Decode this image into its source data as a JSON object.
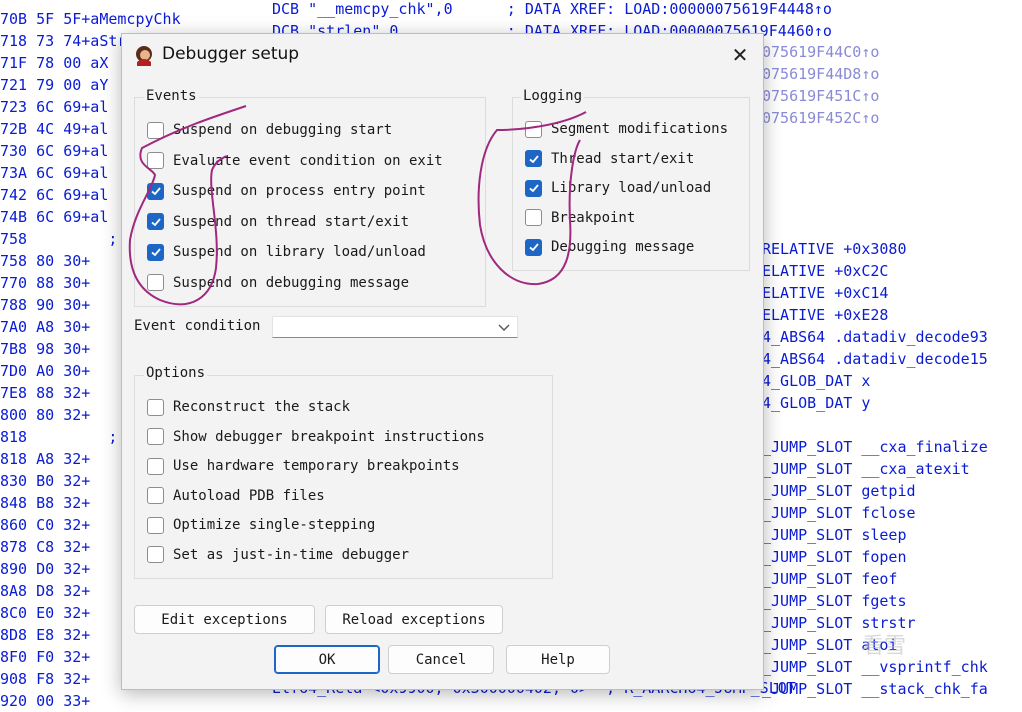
{
  "background": {
    "left_lines": [
      "70B 5F 5F+aMemcpyChk",
      "718 73 74+aStrlen",
      "71F 78 00 aX",
      "721 79 00 aY",
      "723 6C 69+al",
      "72B 4C 49+al",
      "730 6C 69+al",
      "73A 6C 69+al",
      "742 6C 69+al",
      "74B 6C 69+al",
      "758         ;",
      "758 80 30+",
      "770 88 30+",
      "788 90 30+",
      "7A0 A8 30+",
      "7B8 98 30+",
      "7D0 A0 30+",
      "7E8 88 32+",
      "800 80 32+",
      "818         ;",
      "818 A8 32+",
      "830 B0 32+",
      "848 B8 32+",
      "860 C0 32+",
      "878 C8 32+",
      "890 D0 32+",
      "8A8 D8 32+",
      "8C0 E0 32+",
      "8D8 E8 32+",
      "8F0 F0 32+",
      "908 F8 32+",
      "920 00 33+"
    ],
    "top_right_1": "DCB \"__memcpy_chk\",0      ; DATA XREF: LOAD:00000075619F4448↑o",
    "top_right_2": "DCB \"strlen\",0            ; DATA XREF: LOAD:00000075619F4460↑o",
    "xref_lines": [
      "075619F44C0↑o",
      "075619F44D8↑o",
      "075619F451C↑o",
      "075619F452C↑o"
    ],
    "reloc_lines": [
      "RELATIVE +0x3080",
      "ELATIVE +0xC2C",
      "ELATIVE +0xC14",
      "ELATIVE +0xE28",
      "4_ABS64 .datadiv_decode93",
      "4_ABS64 .datadiv_decode15",
      "4_GLOB_DAT x",
      "4_GLOB_DAT y",
      "",
      "_JUMP_SLOT __cxa_finalize",
      "_JUMP_SLOT __cxa_atexit",
      "_JUMP_SLOT getpid",
      "_JUMP_SLOT fclose",
      "_JUMP_SLOT sleep",
      "_JUMP_SLOT fopen",
      "_JUMP_SLOT feof",
      "_JUMP_SLOT fgets",
      "_JUMP_SLOT strstr",
      "_JUMP_SLOT atoi",
      "_JUMP_SLOT __vsprintf_chk",
      "_JUMP_SLOT __stack_chk_fa"
    ],
    "bottom_partial": "Elf64_Rela <0x9900, 0x300000402, 0>  ; R_AARCH64_JUMP_SLOT"
  },
  "dialog": {
    "title": "Debugger setup",
    "close_glyph": "✕",
    "events": {
      "label": "Events",
      "items": [
        {
          "label": "Suspend on debugging start",
          "checked": false
        },
        {
          "label": "Evaluate event condition on exit",
          "checked": false
        },
        {
          "label": "Suspend on process entry point",
          "checked": true
        },
        {
          "label": "Suspend on thread start/exit",
          "checked": true
        },
        {
          "label": "Suspend on library load/unload",
          "checked": true
        },
        {
          "label": "Suspend on debugging message",
          "checked": false
        }
      ]
    },
    "logging": {
      "label": "Logging",
      "items": [
        {
          "label": "Segment modifications",
          "checked": false
        },
        {
          "label": "Thread start/exit",
          "checked": true
        },
        {
          "label": "Library load/unload",
          "checked": true
        },
        {
          "label": "Breakpoint",
          "checked": false
        },
        {
          "label": "Debugging message",
          "checked": true
        }
      ]
    },
    "event_condition": {
      "label": "Event condition",
      "value": ""
    },
    "options": {
      "label": "Options",
      "items": [
        {
          "label": "Reconstruct the stack",
          "checked": false
        },
        {
          "label": "Show debugger breakpoint instructions",
          "checked": false
        },
        {
          "label": "Use hardware temporary breakpoints",
          "checked": false
        },
        {
          "label": "Autoload PDB files",
          "checked": false
        },
        {
          "label": "Optimize single-stepping",
          "checked": false
        },
        {
          "label": "Set as just-in-time debugger",
          "checked": false
        }
      ]
    },
    "buttons": {
      "edit_exceptions": "Edit exceptions",
      "reload_exceptions": "Reload exceptions",
      "ok": "OK",
      "cancel": "Cancel",
      "help": "Help"
    }
  },
  "colors": {
    "code_text": "#0a1bd4",
    "checkbox_checked": "#1d66c6",
    "annotation_ink": "#a0287f"
  },
  "watermark": "看雪"
}
